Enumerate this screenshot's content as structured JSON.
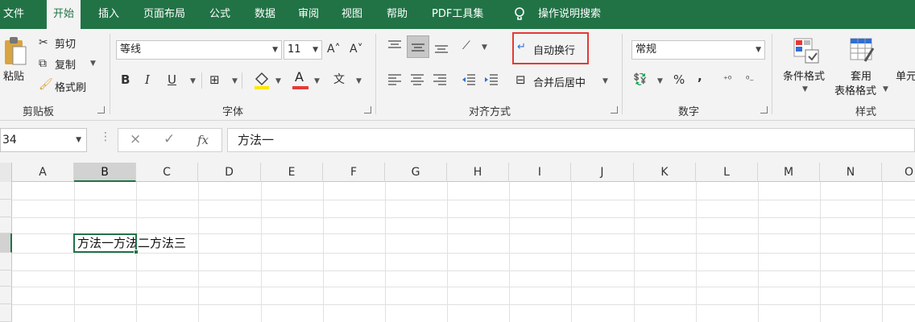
{
  "menu": {
    "tabs": [
      "文件",
      "开始",
      "插入",
      "页面布局",
      "公式",
      "数据",
      "审阅",
      "视图",
      "帮助",
      "PDF工具集"
    ],
    "active_tab": "开始",
    "tell_me": "操作说明搜索"
  },
  "ribbon": {
    "clipboard": {
      "label": "剪贴板",
      "paste": "粘贴",
      "cut": "剪切",
      "copy": "复制",
      "format_painter": "格式刷"
    },
    "font": {
      "label": "字体",
      "font_name": "等线",
      "font_size": "11",
      "grow": "A˄",
      "shrink": "A˅",
      "bold": "B",
      "italic": "I",
      "underline": "U",
      "font_color_letter": "A",
      "phonetic": "文"
    },
    "alignment": {
      "label": "对齐方式",
      "wrap_text": "自动换行",
      "merge_center": "合并后居中"
    },
    "number": {
      "label": "数字",
      "format": "常规",
      "percent": "%",
      "comma": ","
    },
    "styles": {
      "label": "样式",
      "conditional": "条件格式",
      "table_format_line1": "套用",
      "table_format_line2": "表格格式",
      "cell_styles": "单元"
    }
  },
  "formula_bar": {
    "name_box": "B4",
    "name_box_visible": "34",
    "cancel": "×",
    "enter": "✓",
    "fx": "fx",
    "value": "方法一"
  },
  "grid": {
    "columns": [
      "A",
      "B",
      "C",
      "D",
      "E",
      "F",
      "G",
      "H",
      "I",
      "J",
      "K",
      "L",
      "M",
      "N",
      "O"
    ],
    "selected_column": "B",
    "selected_row": "4",
    "cell_text": "方法一方法二方法三"
  },
  "colors": {
    "excel_green": "#217346",
    "highlight_red": "#e53935",
    "fill_yellow": "#ffe600",
    "font_red": "#e53935"
  }
}
